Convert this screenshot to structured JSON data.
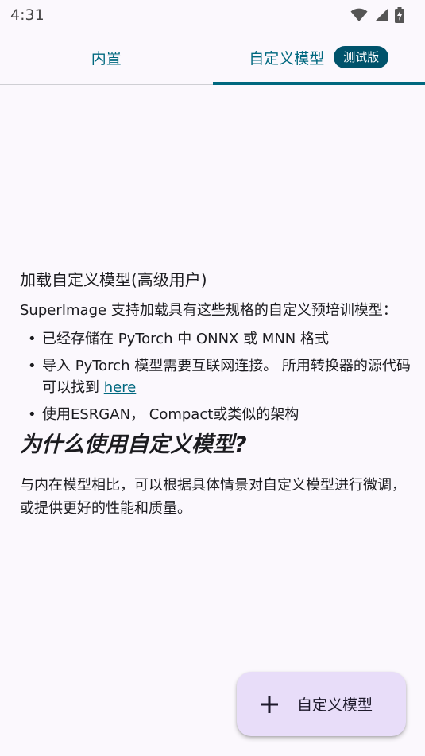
{
  "status_bar": {
    "time": "4:31",
    "icons": [
      "wifi-icon",
      "signal-icon",
      "battery-charging-icon"
    ]
  },
  "tabs": [
    {
      "label": "内置",
      "active": false
    },
    {
      "label": "自定义模型",
      "active": true,
      "badge": "测试版"
    }
  ],
  "content": {
    "title": "加载自定义模型(高级用户)",
    "intro": "SuperImage 支持加载具有这些规格的自定义预培训模型：",
    "bullets": [
      "已经存储在 PyTorch 中 ONNX 或 MNN 格式",
      "导入 PyTorch 模型需要互联网连接。 所用转换器的源代码可以找到 ",
      "使用ESRGAN， Compact或类似的架构"
    ],
    "bullet_link": "here",
    "why_heading": "为什么使用自定义模型?",
    "why_text": "与内在模型相比，可以根据具体情景对自定义模型进行微调，或提供更好的性能和质量。"
  },
  "fab": {
    "icon": "plus-icon",
    "label": "自定义模型"
  },
  "colors": {
    "accent": "#00687f",
    "badge": "#00536b",
    "fab_bg": "#e8ddf9",
    "background": "#fbf8fd"
  }
}
